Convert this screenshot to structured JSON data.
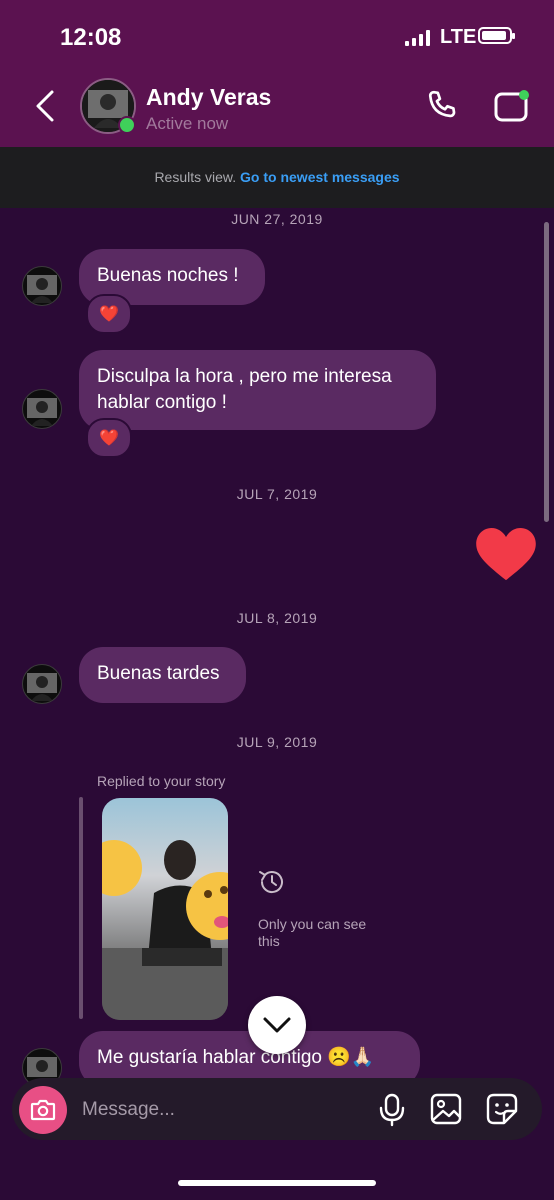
{
  "status_bar": {
    "time": "12:08",
    "network": "LTE"
  },
  "header": {
    "name": "Andy Veras",
    "status": "Active now"
  },
  "results_bar": {
    "prefix": "Results view.",
    "link": "Go to newest messages"
  },
  "messages": {
    "date_1": "JUN 27, 2019",
    "msg_1": "Buenas noches !",
    "msg_1_reaction": "❤️",
    "msg_2": "Disculpa la hora , pero me interesa hablar contigo !",
    "msg_2_reaction": "❤️",
    "date_2": "JUL 7, 2019",
    "date_3": "JUL 8, 2019",
    "msg_3": "Buenas tardes",
    "date_4": "JUL 9, 2019",
    "story_reply_label": "Replied to your story",
    "story_notice": "Only you can see this",
    "msg_4": "Me gustaría hablar contigo ☹️🙏🏻"
  },
  "composer": {
    "placeholder": "Message..."
  },
  "colors": {
    "header_bg": "#5b1250",
    "chat_bg": "#2b0a36",
    "bubble": "#5a2a62",
    "link": "#3a9ef5",
    "online": "#3fd05a",
    "heart": "#f23a48"
  }
}
